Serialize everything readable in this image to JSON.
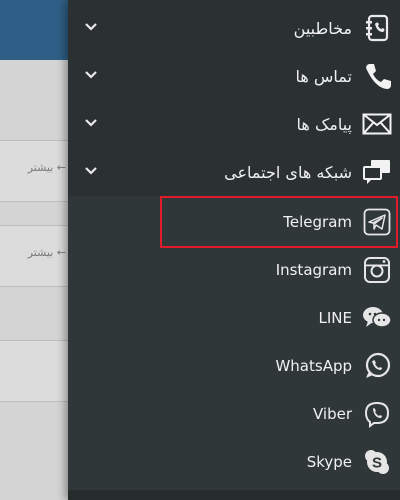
{
  "background": {
    "cards": [
      {
        "more_text": "بیشتر ← "
      },
      {
        "more_text": "بیشتر ← "
      }
    ]
  },
  "menu": {
    "main_items": [
      {
        "label": "مخاطبین",
        "icon": "contacts-book-icon"
      },
      {
        "label": "تماس ها",
        "icon": "phone-icon"
      },
      {
        "label": "پیامک ها",
        "icon": "envelope-icon"
      },
      {
        "label": "شبکه های اجتماعی",
        "icon": "chat-bubbles-icon"
      }
    ],
    "social_items": [
      {
        "label": "Telegram",
        "icon": "telegram-icon",
        "highlighted": true
      },
      {
        "label": "Instagram",
        "icon": "instagram-icon"
      },
      {
        "label": "LINE",
        "icon": "line-icon"
      },
      {
        "label": "WhatsApp",
        "icon": "whatsapp-icon"
      },
      {
        "label": "Viber",
        "icon": "viber-icon"
      },
      {
        "label": "Skype",
        "icon": "skype-icon"
      }
    ]
  },
  "colors": {
    "drawer_bg": "#2b3133",
    "subpanel_bg": "#303738",
    "highlight_border": "#e01b2a",
    "header_bg": "#2f5f86"
  }
}
